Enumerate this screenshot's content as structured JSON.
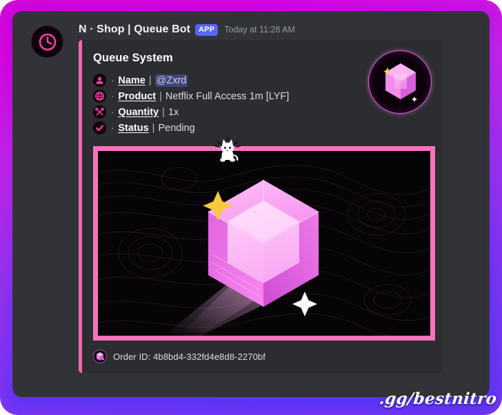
{
  "frame": {
    "gradient_start": "#c800d8",
    "gradient_end": "#5533f5",
    "watermark": ".gg/bestnitro"
  },
  "message": {
    "avatar_icon": "clock-icon",
    "author": "N · Shop | Queue Bot",
    "app_badge": "APP",
    "timestamp": "Today at 11:28 AM"
  },
  "embed": {
    "accent_color": "#f06bb2",
    "title": "Queue System",
    "thumbnail_icon": "pink-gem-icon",
    "fields": [
      {
        "emoji": "person-icon",
        "bullet": "·",
        "label": "Name",
        "separator": "|",
        "value": "@Zxrd",
        "is_mention": true
      },
      {
        "emoji": "globe-icon",
        "bullet": "·",
        "label": "Product",
        "separator": "|",
        "value": "Netflix Full Access 1m [LYF]",
        "is_mention": false
      },
      {
        "emoji": "tools-icon",
        "bullet": "·",
        "label": "Quantity",
        "separator": "|",
        "value": "1x",
        "is_mention": false
      },
      {
        "emoji": "check-icon",
        "bullet": "·",
        "label": "Status",
        "separator": "|",
        "value": "Pending",
        "is_mention": false
      }
    ],
    "image": {
      "alt": "pink-gem-artwork",
      "border_color": "#f574bd",
      "background_color": "#060406",
      "sticker": "white-cat-sticker",
      "sparkle_gold": "#f7c93e",
      "sparkle_white": "#ffffff",
      "gem_light": "#ffc9f4",
      "gem_mid": "#ef7ae6",
      "gem_dark": "#c84fd4"
    },
    "footer": {
      "icon": "pink-gem-icon",
      "text": "Order ID: 4b8bd4-332fd4e8d8-2270bf"
    }
  }
}
